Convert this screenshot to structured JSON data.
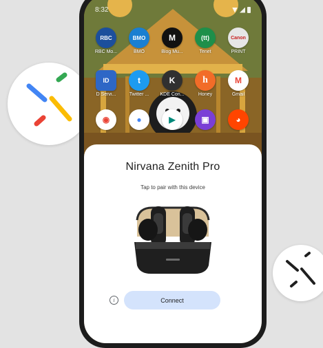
{
  "status_bar": {
    "time": "8:32"
  },
  "apps": [
    {
      "label": "RBC Mo...",
      "icon": "rbc-icon",
      "glyph": "RBC",
      "color": "#1c4f9c"
    },
    {
      "label": "BMO",
      "icon": "bmo-icon",
      "glyph": "BMO",
      "color": "#1a7fd1"
    },
    {
      "label": "Blog Mu...",
      "icon": "blog-icon",
      "glyph": "M",
      "color": "#111111"
    },
    {
      "label": "Tenet",
      "icon": "tenet-icon",
      "glyph": "(tt)",
      "color": "#1e8f4a"
    },
    {
      "label": "PRINT",
      "icon": "print-icon",
      "glyph": "Canon",
      "color": "#e6e6e6"
    },
    {
      "label": "D Servi...",
      "icon": "contact-card-icon",
      "glyph": "ID",
      "color": "#2e67c6"
    },
    {
      "label": "Twitter ...",
      "icon": "twitter-icon",
      "glyph": "t",
      "color": "#1d9bf0"
    },
    {
      "label": "KDE Con...",
      "icon": "kde-connect-icon",
      "glyph": "K",
      "color": "#303030"
    },
    {
      "label": "Honey",
      "icon": "honey-icon",
      "glyph": "h",
      "color": "#f26c28"
    },
    {
      "label": "Gmail",
      "icon": "gmail-icon",
      "glyph": "M",
      "color": "#ffffff"
    },
    {
      "label": "",
      "icon": "maps-icon",
      "glyph": "◉",
      "color": "#ffffff"
    },
    {
      "label": "",
      "icon": "assistant-icon",
      "glyph": "●",
      "color": "#ffffff"
    },
    {
      "label": "",
      "icon": "meet-icon",
      "glyph": "▶",
      "color": "#ffffff"
    },
    {
      "label": "",
      "icon": "twitch-icon",
      "glyph": "▣",
      "color": "#7a3fd6"
    },
    {
      "label": "",
      "icon": "reddit-icon",
      "glyph": "◕",
      "color": "#ff4500"
    }
  ],
  "sheet": {
    "title": "Nirvana Zenith Pro",
    "subtitle": "Tap to pair with this device",
    "connect_label": "Connect",
    "info_glyph": "i"
  },
  "colors": {
    "connect_bg": "#d4e3fc",
    "fast_pair_blue": "#4285f4",
    "fast_pair_green": "#34a853",
    "fast_pair_yellow": "#fbbc04",
    "fast_pair_red": "#ea4335"
  }
}
